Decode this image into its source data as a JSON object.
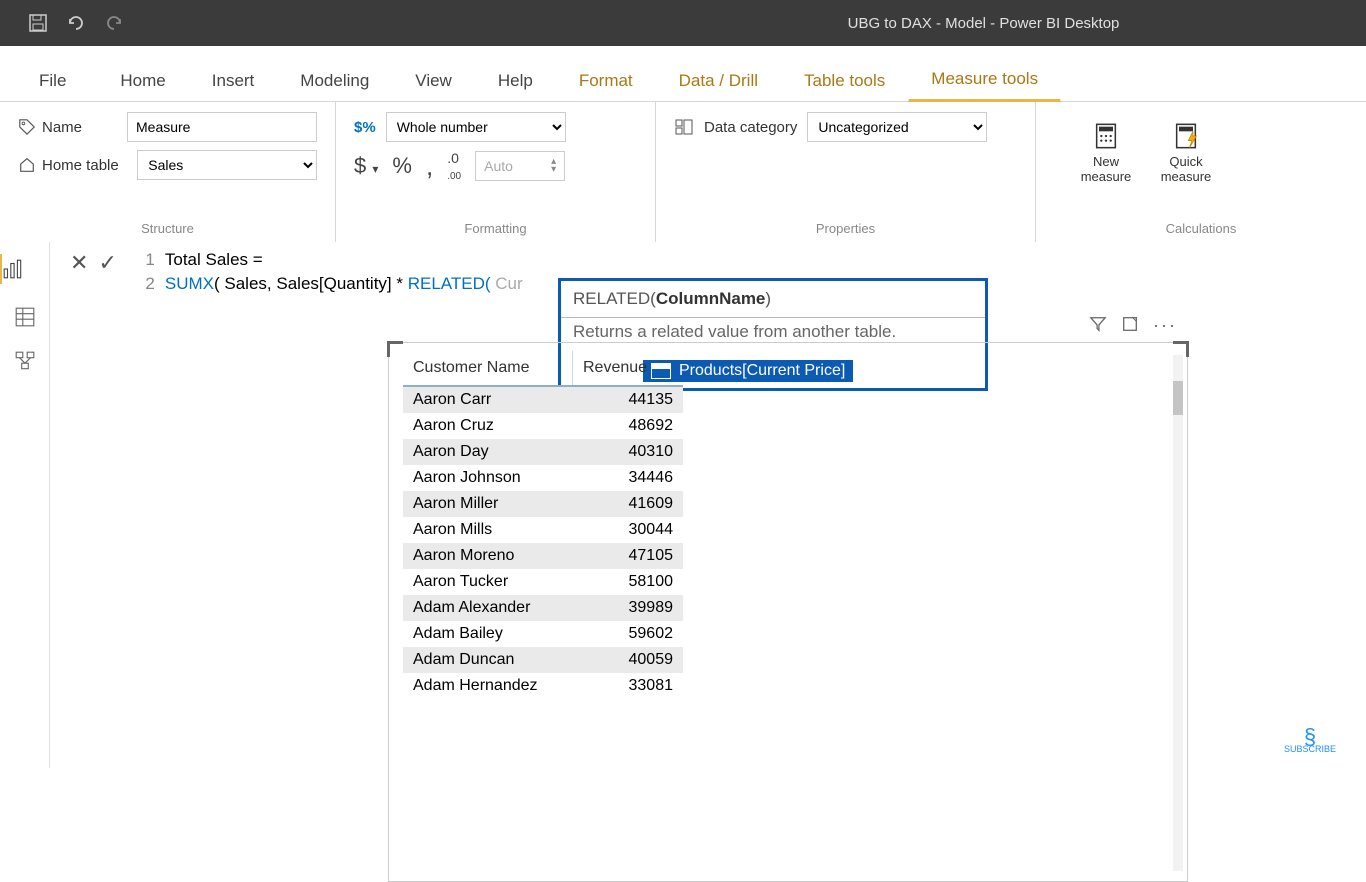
{
  "titlebar": {
    "title": "UBG to DAX - Model - Power BI Desktop"
  },
  "menu": {
    "file": "File",
    "home": "Home",
    "insert": "Insert",
    "modeling": "Modeling",
    "view": "View",
    "help": "Help",
    "format": "Format",
    "datadrill": "Data / Drill",
    "tabletools": "Table tools",
    "measuretools": "Measure tools"
  },
  "ribbon": {
    "structure": {
      "name_label": "Name",
      "name_value": "Measure",
      "home_table_label": "Home table",
      "home_table_value": "Sales",
      "group_label": "Structure"
    },
    "formatting": {
      "format_value": "Whole number",
      "auto_placeholder": "Auto",
      "symbols": {
        "dollar": "$",
        "percent": "%",
        "comma": ",",
        "decimals_icon": ".0₀"
      },
      "group_label": "Formatting"
    },
    "properties": {
      "data_category_label": "Data category",
      "data_category_value": "Uncategorized",
      "group_label": "Properties"
    },
    "calculations": {
      "new_measure": "New measure",
      "quick_measure": "Quick measure",
      "group_label": "Calculations"
    }
  },
  "formula": {
    "line1": {
      "text": "Total Sales ="
    },
    "line2": {
      "fn": "SUMX",
      "open": "( ",
      "tbl": "Sales",
      "sep": ", ",
      "col": "Sales[Quantity]",
      "mult": " * ",
      "related": "RELATED(",
      "hint": " Cur"
    }
  },
  "intellisense": {
    "signature_pre": "RELATED(",
    "signature_bold": "ColumnName",
    "signature_post": ")",
    "description": "Returns a related value from another table.",
    "suggestion": "Products[Current Price]"
  },
  "visual_toolbar": {
    "filter": "filter",
    "focus": "focus",
    "more": "..."
  },
  "table": {
    "headers": {
      "c1": "Customer Name",
      "c2": "Revenue"
    },
    "rows": [
      {
        "c1": "Aaron Carr",
        "c2": "44135"
      },
      {
        "c1": "Aaron Cruz",
        "c2": "48692"
      },
      {
        "c1": "Aaron Day",
        "c2": "40310"
      },
      {
        "c1": "Aaron Johnson",
        "c2": "34446"
      },
      {
        "c1": "Aaron Miller",
        "c2": "41609"
      },
      {
        "c1": "Aaron Mills",
        "c2": "30044"
      },
      {
        "c1": "Aaron Moreno",
        "c2": "47105"
      },
      {
        "c1": "Aaron Tucker",
        "c2": "58100"
      },
      {
        "c1": "Adam Alexander",
        "c2": "39989"
      },
      {
        "c1": "Adam Bailey",
        "c2": "59602"
      },
      {
        "c1": "Adam Duncan",
        "c2": "40059"
      },
      {
        "c1": "Adam Hernandez",
        "c2": "33081"
      }
    ]
  },
  "subscribe": "SUBSCRIBE"
}
